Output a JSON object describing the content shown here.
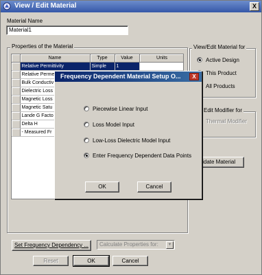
{
  "window": {
    "title": "View / Edit Material",
    "close_glyph": "X"
  },
  "material_name": {
    "label": "Material Name",
    "value": "Material1"
  },
  "properties_group": {
    "title": "Properties of the Material",
    "columns": [
      "Name",
      "Type",
      "Value",
      "Units"
    ],
    "rows": [
      {
        "name": "Relative Permittivity",
        "type": "Simple",
        "value": "1",
        "units": ""
      },
      {
        "name": "Relative Perme",
        "type": "",
        "value": "",
        "units": ""
      },
      {
        "name": "Bulk Conductiv",
        "type": "",
        "value": "",
        "units": ""
      },
      {
        "name": "Dielectric Loss",
        "type": "",
        "value": "",
        "units": ""
      },
      {
        "name": "Magnetic Loss",
        "type": "",
        "value": "",
        "units": ""
      },
      {
        "name": "Magnetic Satu",
        "type": "",
        "value": "",
        "units": ""
      },
      {
        "name": "Lande G Facto",
        "type": "",
        "value": "",
        "units": ""
      },
      {
        "name": "Delta H",
        "type": "",
        "value": "",
        "units": ""
      },
      {
        "name": "- Measured Fr",
        "type": "",
        "value": "",
        "units": ""
      }
    ]
  },
  "view_edit_group": {
    "title": "View/Edit Material for",
    "options": [
      "Active Design",
      "This Product",
      "All Products"
    ],
    "selected": "Active Design"
  },
  "modifier_group": {
    "title": "Edit Modifier for",
    "item": "Thermal Modifier"
  },
  "validate_button": "alidate Material",
  "set_freq_button": "Set Frequency Dependency ...",
  "calc_combo": "Calculate Properties for:",
  "footer": {
    "reset": "Reset",
    "ok": "OK",
    "cancel": "Cancel"
  },
  "dialog": {
    "title": "Frequency Dependent Material Setup O...",
    "close_glyph": "X",
    "options": [
      "Piecewise Linear Input",
      "Loss Model Input",
      "Low-Loss Dielectric Model Input",
      "Enter Frequency Dependent Data Points"
    ],
    "selected_index": 3,
    "ok": "OK",
    "cancel": "Cancel"
  },
  "colors": {
    "title_bar": "#3557a8",
    "selection": "#0a246a",
    "face": "#d4d0c8"
  }
}
